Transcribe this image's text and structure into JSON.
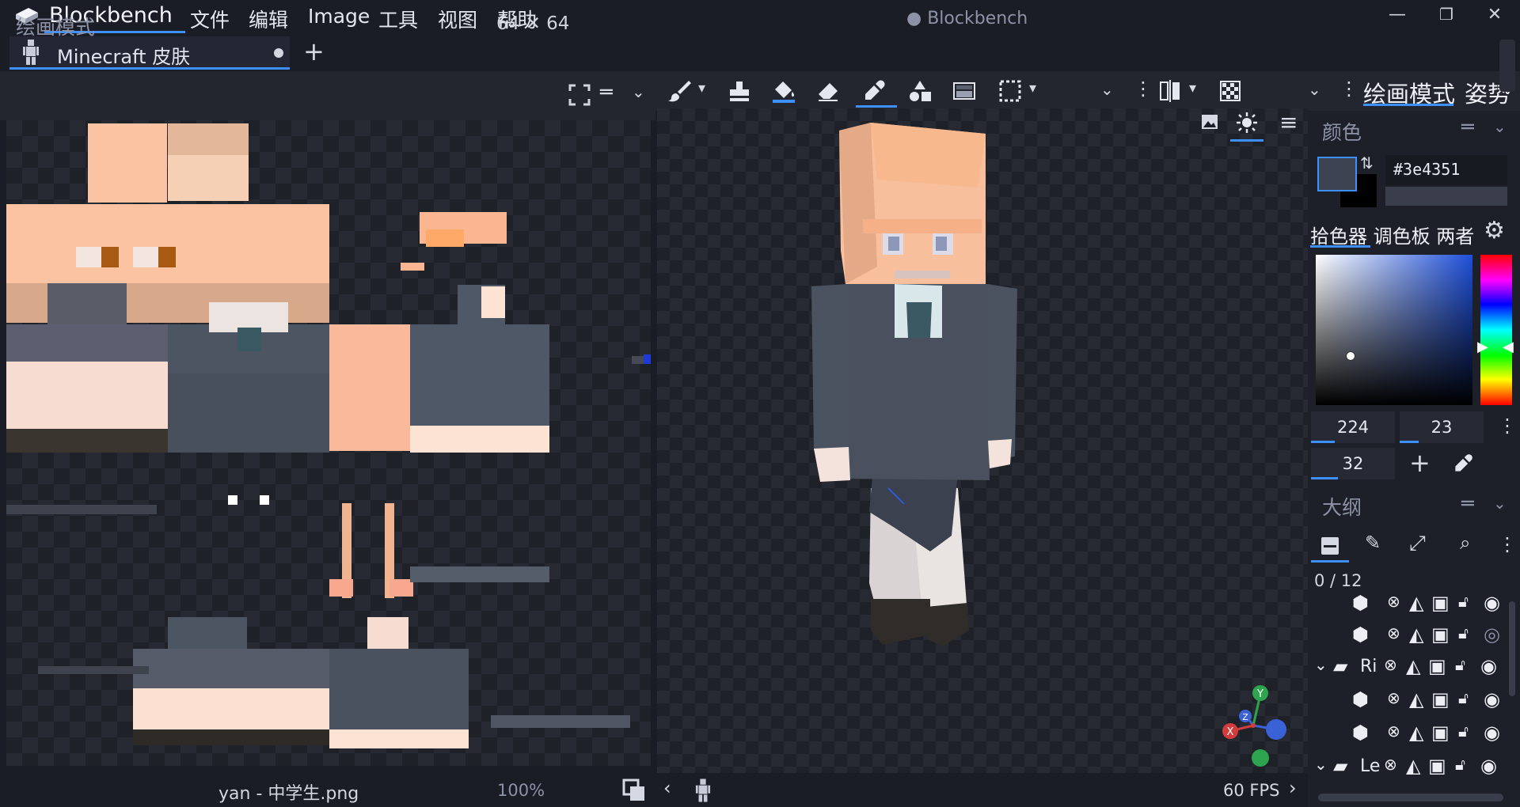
{
  "app": {
    "name": "Blockbench",
    "window_title": "● Blockbench"
  },
  "menu": [
    "文件",
    "编辑",
    "Image",
    "工具",
    "视图",
    "帮助"
  ],
  "tabs": [
    {
      "label": "Minecraft 皮肤",
      "unsaved": true
    }
  ],
  "uv_panel": {
    "title": "绘画模式",
    "size": "64 ✕ 64",
    "file_name": "yan - 中学生.png",
    "zoom": "100%"
  },
  "mode_tabs": {
    "paint": "绘画模式",
    "pose": "姿势"
  },
  "color_panel": {
    "title": "颜色",
    "hex": "#3e4351",
    "picker_tabs": "拾色器 调色板 两者",
    "h": "224",
    "s": "23",
    "v": "32",
    "accent": "#3e90ff",
    "current_color": "#3e4351"
  },
  "outline_panel": {
    "title": "大纲",
    "count": "0 / 12",
    "rows": [
      {
        "type": "cube",
        "label": ""
      },
      {
        "type": "cube",
        "label": ""
      },
      {
        "type": "folder",
        "label": "Ri"
      },
      {
        "type": "cube",
        "label": ""
      },
      {
        "type": "cube",
        "label": ""
      },
      {
        "type": "folder",
        "label": "Le"
      }
    ]
  },
  "viewport": {
    "fps": "60 FPS"
  },
  "gizmo": {
    "x": "X",
    "y": "Y",
    "z": "Z"
  }
}
